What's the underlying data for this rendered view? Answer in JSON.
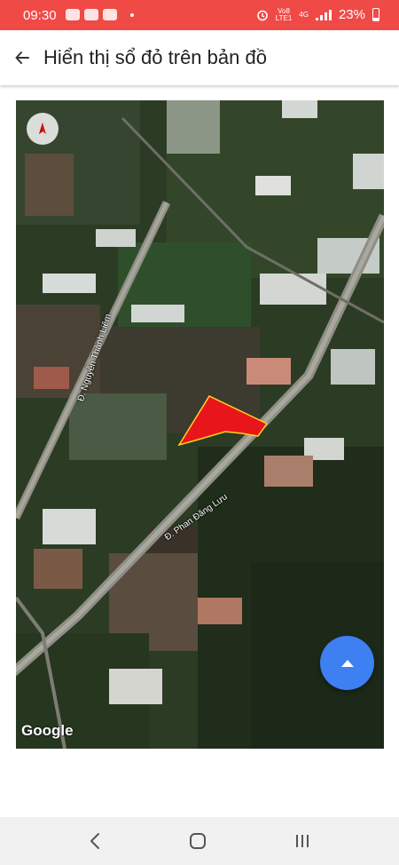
{
  "status_bar": {
    "time": "09:30",
    "battery": "23%",
    "network_top": "Vo8",
    "network_bottom": "LTE1",
    "network_type": "4G",
    "icons": [
      "notification-icon",
      "app-icon",
      "image-icon",
      "alarm-icon",
      "signal-icon",
      "battery-icon"
    ]
  },
  "app_bar": {
    "title": "Hiển thị sổ đỏ trên bản đồ",
    "back_icon": "arrow-left-icon"
  },
  "map": {
    "streets": [
      "Đ. Nguyễn Thành Liêm",
      "Đ. Phan Đăng Lưu"
    ],
    "attribution": "Google",
    "view_type": "satellite",
    "parcel_color": "#e8161b",
    "parcel_outline_color": "#ffd21a",
    "compass_icon": "compass-icon",
    "fab_icon": "chevron-up-icon",
    "fab_color": "#3e7ff2"
  },
  "nav_bar": {
    "buttons": [
      "back-icon",
      "home-icon",
      "recent-apps-icon"
    ]
  }
}
